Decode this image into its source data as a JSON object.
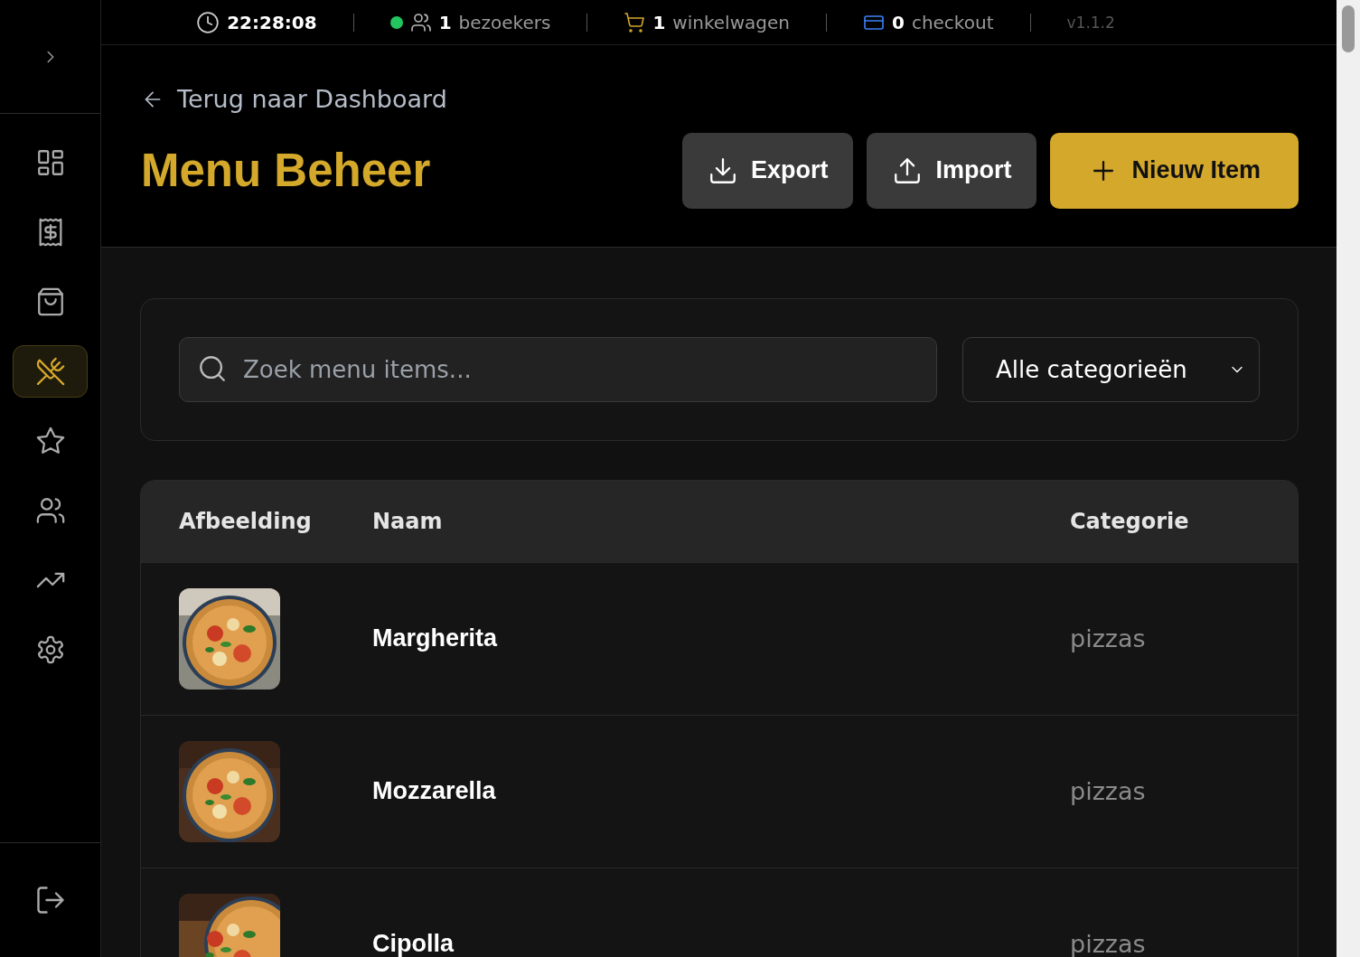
{
  "sidebar": {
    "items": [
      {
        "selected": false
      },
      {
        "selected": false
      },
      {
        "selected": false
      },
      {
        "selected": true
      },
      {
        "selected": false
      },
      {
        "selected": false
      },
      {
        "selected": false
      },
      {
        "selected": false
      }
    ]
  },
  "status_bar": {
    "time": "22:28:08",
    "stats": [
      {
        "online": true,
        "count": "1",
        "label": "bezoekers"
      },
      {
        "count": "1",
        "label": "winkelwagen"
      },
      {
        "count": "0",
        "label": "checkout"
      }
    ],
    "version": "v1.1.2"
  },
  "back_link": "Terug naar Dashboard",
  "title": "Menu Beheer",
  "actions": [
    {
      "kind": "export",
      "label": "Export"
    },
    {
      "kind": "import",
      "label": "Import"
    },
    {
      "kind": "add",
      "label": "Nieuw Item"
    }
  ],
  "search": {
    "placeholder": "Zoek menu items..."
  },
  "category_filter": {
    "value": "Alle categorieën"
  },
  "table": {
    "columns": [
      "Afbeelding",
      "Naam",
      "Categorie"
    ],
    "rows": [
      {
        "name": "Margherita",
        "category": "pizzas"
      },
      {
        "name": "Mozzarella",
        "category": "pizzas"
      },
      {
        "name": "Cipolla",
        "category": "pizzas"
      }
    ]
  }
}
